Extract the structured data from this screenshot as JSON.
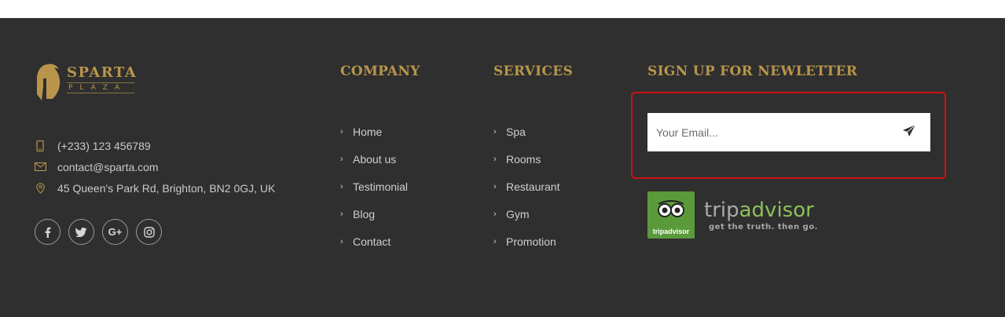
{
  "brand": {
    "name": "SPARTA",
    "sub": "PLAZA"
  },
  "contact": {
    "phone": "(+233) 123 456789",
    "email": "contact@sparta.com",
    "address": "45 Queen's Park Rd, Brighton, BN2 0GJ, UK"
  },
  "social": [
    {
      "icon": "facebook-icon",
      "glyph": "f"
    },
    {
      "icon": "twitter-icon",
      "glyph": "t"
    },
    {
      "icon": "google-plus-icon",
      "glyph": "G+"
    },
    {
      "icon": "instagram-icon",
      "glyph": "ig"
    }
  ],
  "company": {
    "heading": "COMPANY",
    "links": [
      "Home",
      "About us",
      "Testimonial",
      "Blog",
      "Contact"
    ]
  },
  "services": {
    "heading": "SERVICES",
    "links": [
      "Spa",
      "Rooms",
      "Restaurant",
      "Gym",
      "Promotion"
    ]
  },
  "newsletter": {
    "heading": "SIGN UP FOR NEWLETTER",
    "placeholder": "Your Email...",
    "send_icon": "paper-plane-icon"
  },
  "tripadvisor": {
    "word_trip": "trip",
    "word_advisor": "advisor",
    "tagline": "get the truth. then go.",
    "badge_text": "tripadvisor"
  },
  "colors": {
    "background": "#2f2f2f",
    "accent": "#b8954a",
    "highlight": "#cc1111",
    "tripadvisor_green": "#8cc05a"
  }
}
